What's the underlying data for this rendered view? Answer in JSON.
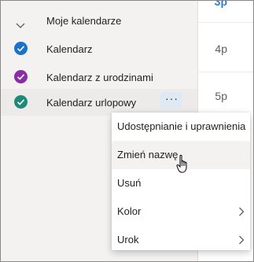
{
  "calendars": {
    "group_title": "Moje kalendarze",
    "items": [
      {
        "label": "Kalendarz",
        "color": "#1a73c8"
      },
      {
        "label": "Kalendarz z urodzinami",
        "color": "#8a2da5"
      },
      {
        "label": "Kalendarz urlopowy",
        "color": "#1e8a7a"
      }
    ],
    "more_button": "···"
  },
  "timeline": {
    "top_label": "3p",
    "hours": [
      "4p",
      "5p"
    ]
  },
  "context_menu": {
    "items": [
      {
        "label": "Udostępnianie i uprawnienia",
        "submenu": false
      },
      {
        "label": "Zmień nazwę",
        "submenu": false
      },
      {
        "label": "Usuń",
        "submenu": false
      },
      {
        "label": "Kolor",
        "submenu": true
      },
      {
        "label": "Urok",
        "submenu": true
      }
    ]
  },
  "colors": {
    "accent_blue": "#1a73c8",
    "hover_bg": "#f3f2f1"
  }
}
